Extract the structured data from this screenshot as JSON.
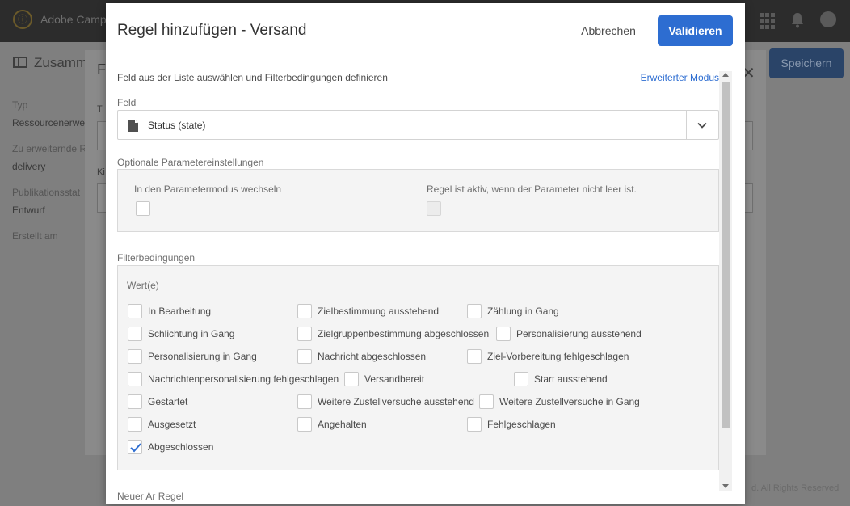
{
  "app": {
    "name": "Adobe Campa",
    "summary_title": "Zusamm",
    "save_label": "Speichern",
    "footer": "d. All Rights Reserved"
  },
  "background_fields": [
    {
      "label": "Typ",
      "value": "Ressourcenerwei"
    },
    {
      "label": "Zu erweiternde R",
      "value": "delivery"
    },
    {
      "label": "Publikationsstat",
      "value": "Entwurf"
    },
    {
      "label": "Erstellt am",
      "value": ""
    }
  ],
  "middle_dialog": {
    "title_letter": "F",
    "label1": "Ti",
    "label2": "Ki"
  },
  "modal": {
    "title": "Regel hinzufügen - Versand",
    "cancel_label": "Abbrechen",
    "validate_label": "Validieren",
    "intro": "Feld aus der Liste auswählen und Filterbedingungen definieren",
    "advanced_mode_link": "Erweiterter Modus",
    "field_section_label": "Feld",
    "field_value": "Status (state)",
    "optional_params_label": "Optionale Parametereinstellungen",
    "param_mode_label": "In den Parametermodus wechseln",
    "rule_active_label": "Regel ist aktiv, wenn der Parameter nicht leer ist.",
    "filter_conditions_label": "Filterbedingungen",
    "values_label": "Wert(e)",
    "next_section_label": "Neuer Ar Regel"
  },
  "options": [
    {
      "label": "In Bearbeitung",
      "checked": false
    },
    {
      "label": "Zielbestimmung ausstehend",
      "checked": false
    },
    {
      "label": "Zählung in Gang",
      "checked": false
    },
    {
      "label": "Schlichtung in Gang",
      "checked": false
    },
    {
      "label": "Zielgruppenbestimmung abgeschlossen",
      "checked": false
    },
    {
      "label": "Personalisierung ausstehend",
      "checked": false
    },
    {
      "label": "Personalisierung in Gang",
      "checked": false
    },
    {
      "label": "Nachricht abgeschlossen",
      "checked": false
    },
    {
      "label": "Ziel-Vorbereitung fehlgeschlagen",
      "checked": false
    },
    {
      "label": "Nachrichtenpersonalisierung fehlgeschlagen",
      "checked": false
    },
    {
      "label": "Versandbereit",
      "checked": false
    },
    {
      "label": "Start ausstehend",
      "checked": false
    },
    {
      "label": "Gestartet",
      "checked": false
    },
    {
      "label": "Weitere Zustellversuche ausstehend",
      "checked": false
    },
    {
      "label": "Weitere Zustellversuche in Gang",
      "checked": false
    },
    {
      "label": "Ausgesetzt",
      "checked": false
    },
    {
      "label": "Angehalten",
      "checked": false
    },
    {
      "label": "Fehlgeschlagen",
      "checked": false
    },
    {
      "label": "Abgeschlossen",
      "checked": true
    }
  ],
  "colors": {
    "accent": "#2d6dd1",
    "checkmark": "#2d6dd1"
  }
}
